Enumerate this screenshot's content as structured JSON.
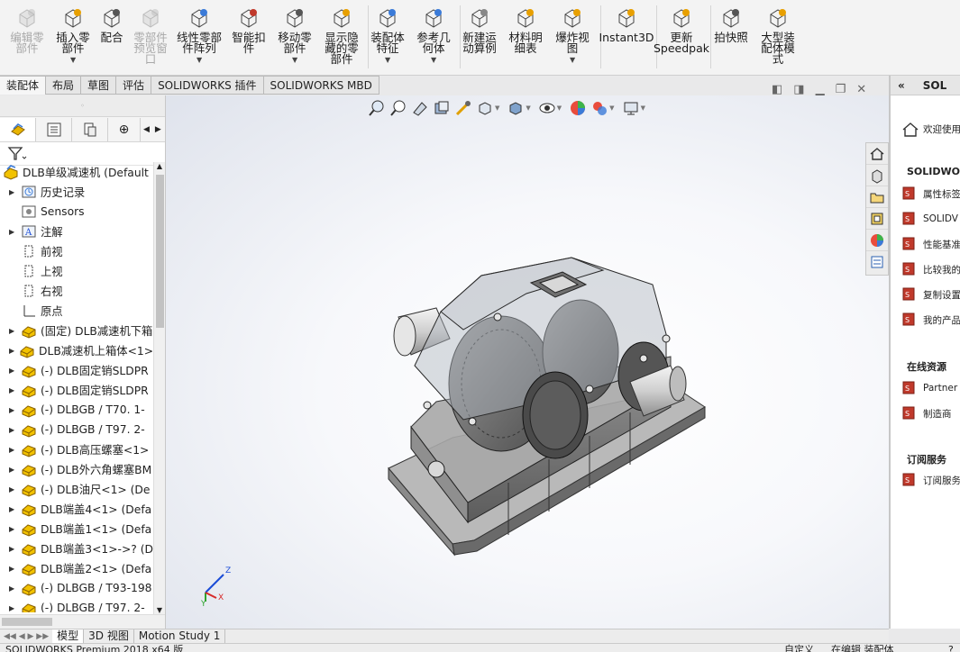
{
  "ribbon": {
    "buttons": [
      {
        "id": "edit",
        "label": "编辑零\n部件",
        "disabled": true
      },
      {
        "id": "insert",
        "label": "插入零\n部件",
        "disabled": false,
        "dropdown": true
      },
      {
        "id": "mate",
        "label": "配合",
        "disabled": false
      },
      {
        "id": "preview",
        "label": "零部件\n预览窗\n口",
        "disabled": true
      },
      {
        "id": "pattern",
        "label": "线性零部\n件阵列",
        "disabled": false,
        "dropdown": true
      },
      {
        "id": "smart",
        "label": "智能扣\n件",
        "disabled": false
      },
      {
        "id": "move",
        "label": "移动零\n部件",
        "disabled": false,
        "dropdown": true
      },
      {
        "id": "show",
        "label": "显示隐\n藏的零\n部件",
        "disabled": false
      },
      {
        "id": "asmfeat",
        "label": "装配体\n特征",
        "disabled": false,
        "dropdown": true
      },
      {
        "id": "refgeo",
        "label": "参考几\n何体",
        "disabled": false,
        "dropdown": true
      },
      {
        "id": "motion",
        "label": "新建运\n动算例",
        "disabled": false
      },
      {
        "id": "bom",
        "label": "材料明\n细表",
        "disabled": false
      },
      {
        "id": "explode",
        "label": "爆炸视\n图",
        "disabled": false,
        "dropdown": true
      },
      {
        "id": "instant",
        "label": "Instant3D",
        "disabled": false
      },
      {
        "id": "speedpak",
        "label": "更新\nSpeedpak",
        "disabled": false
      },
      {
        "id": "snapshot",
        "label": "拍快照",
        "disabled": false
      },
      {
        "id": "large",
        "label": "大型装\n配体模\n式",
        "disabled": false
      }
    ]
  },
  "tabs": [
    "装配体",
    "布局",
    "草图",
    "评估",
    "SOLIDWORKS 插件",
    "SOLIDWORKS MBD"
  ],
  "tree": {
    "root": "DLB单级减速机 (Default",
    "items": [
      {
        "label": "历史记录",
        "icon": "history",
        "expand": true
      },
      {
        "label": "Sensors",
        "icon": "sensor",
        "expand": false
      },
      {
        "label": "注解",
        "icon": "annotation",
        "expand": true
      },
      {
        "label": "前视",
        "icon": "plane",
        "expand": false
      },
      {
        "label": "上视",
        "icon": "plane",
        "expand": false
      },
      {
        "label": "右视",
        "icon": "plane",
        "expand": false
      },
      {
        "label": "原点",
        "icon": "origin",
        "expand": false
      },
      {
        "label": "(固定) DLB减速机下箱",
        "icon": "part",
        "expand": true
      },
      {
        "label": "DLB减速机上箱体<1>",
        "icon": "part",
        "expand": true
      },
      {
        "label": "(-) DLB固定销SLDPR",
        "icon": "part",
        "expand": true
      },
      {
        "label": "(-) DLB固定销SLDPR",
        "icon": "part",
        "expand": true
      },
      {
        "label": "(-) DLBGB / T70.  1-",
        "icon": "part",
        "expand": true
      },
      {
        "label": "(-) DLBGB / T97.  2-",
        "icon": "part",
        "expand": true
      },
      {
        "label": "(-) DLB高压螺塞<1>",
        "icon": "part",
        "expand": true
      },
      {
        "label": "(-) DLB外六角螺塞BM",
        "icon": "part",
        "expand": true
      },
      {
        "label": "(-) DLB油尺<1> (De",
        "icon": "part",
        "expand": true
      },
      {
        "label": "DLB端盖4<1> (Defa",
        "icon": "part",
        "expand": true
      },
      {
        "label": "DLB端盖1<1> (Defa",
        "icon": "part",
        "expand": true
      },
      {
        "label": "DLB端盖3<1>->? (D",
        "icon": "part",
        "expand": true
      },
      {
        "label": "DLB端盖2<1> (Defa",
        "icon": "part",
        "expand": true
      },
      {
        "label": "(-) DLBGB / T93-198",
        "icon": "part",
        "expand": true
      },
      {
        "label": "(-) DLBGB / T97.  2-",
        "icon": "part",
        "expand": true
      }
    ]
  },
  "right_panel": {
    "header": "SOL",
    "welcome": "欢迎使用",
    "section1": "SOLIDWORK",
    "items1": [
      "属性标签",
      "SOLIDV",
      "性能基准",
      "比较我的",
      "复制设置",
      "我的产品"
    ],
    "section2": "在线资源",
    "items2": [
      "Partner",
      "制造商"
    ],
    "section3": "订阅服务",
    "items3": [
      "订阅服务"
    ]
  },
  "bottom_tabs": [
    "模型",
    "3D 视图",
    "Motion Study 1"
  ],
  "status": {
    "left": "SOLIDWORKS Premium 2018 x64 版",
    "custom": "自定义",
    "mode": "在编辑 装配体",
    "right": "?"
  },
  "triad": {
    "x": "X",
    "y": "Y",
    "z": "Z"
  },
  "colors": {
    "accent": "#e8a000",
    "selected": "#cfe3f7"
  }
}
